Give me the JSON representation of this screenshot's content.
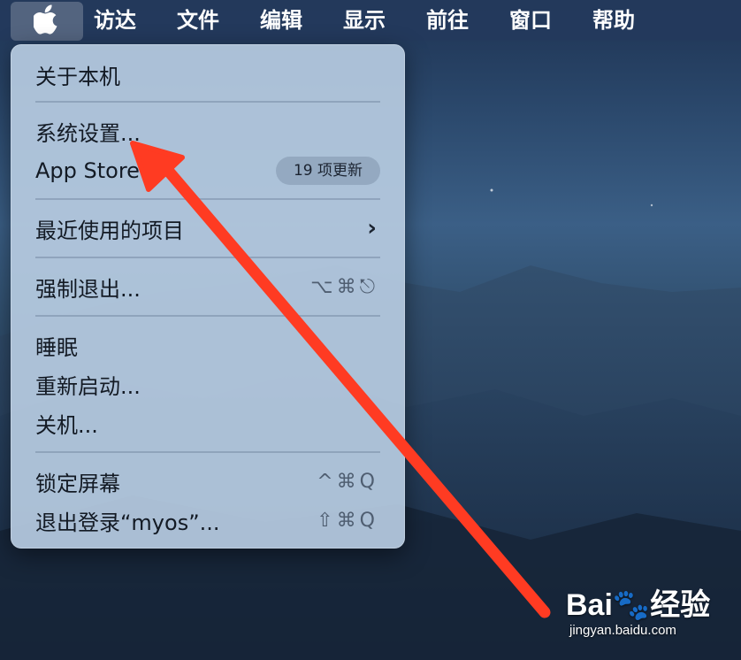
{
  "menubar": {
    "apple_icon": "apple-logo",
    "items": [
      "访达",
      "文件",
      "编辑",
      "显示",
      "前往",
      "窗口",
      "帮助"
    ]
  },
  "apple_menu": {
    "about": "关于本机",
    "system_settings": "系统设置...",
    "app_store": "App Store",
    "app_store_badge": "19 项更新",
    "recent_items": "最近使用的项目",
    "force_quit": "强制退出...",
    "force_quit_shortcut": "⌥⌘⎋",
    "sleep": "睡眠",
    "restart": "重新启动...",
    "shutdown": "关机...",
    "lock_screen": "锁定屏幕",
    "lock_screen_shortcut": "^⌘Q",
    "logout": "退出登录“myos”...",
    "logout_shortcut": "⇧⌘Q"
  },
  "annotation": {
    "arrow_color": "#ff3b22",
    "arrow_target": "系统设置..."
  },
  "watermark": {
    "logo_text": "Bai🐾经验",
    "url": "jingyan.baidu.com"
  }
}
